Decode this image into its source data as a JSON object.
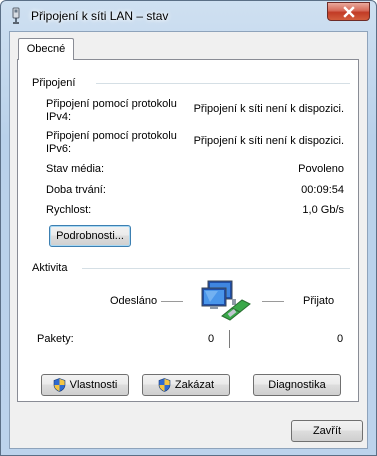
{
  "window": {
    "title": "Připojení k síti LAN – stav"
  },
  "tabs": [
    {
      "label": "Obecné"
    }
  ],
  "connection": {
    "group_label": "Připojení",
    "rows": [
      {
        "label": "Připojení pomocí protokolu IPv4:",
        "label_line1": "Připojení pomocí protokolu",
        "label_line2": "IPv4:",
        "value": "Připojení k síti není k dispozici."
      },
      {
        "label": "Připojení pomocí protokolu IPv6:",
        "label_line1": "Připojení pomocí protokolu",
        "label_line2": "IPv6:",
        "value": "Připojení k síti není k dispozici."
      },
      {
        "label": "Stav média:",
        "value": "Povoleno"
      },
      {
        "label": "Doba trvání:",
        "value": "00:09:54"
      },
      {
        "label": "Rychlost:",
        "value": "1,0 Gb/s"
      }
    ],
    "details_button": "Podrobnosti..."
  },
  "activity": {
    "group_label": "Aktivita",
    "sent_label": "Odesláno",
    "received_label": "Přijato",
    "packets_label": "Pakety:",
    "packets_sent": "0",
    "packets_received": "0"
  },
  "actions": {
    "properties": "Vlastnosti",
    "disable": "Zakázat",
    "diagnose": "Diagnostika"
  },
  "footer": {
    "close": "Zavřít"
  },
  "colors": {
    "frame": "#b9d1ea",
    "close_button": "#c23b26",
    "focus": "#3c7fb1"
  }
}
